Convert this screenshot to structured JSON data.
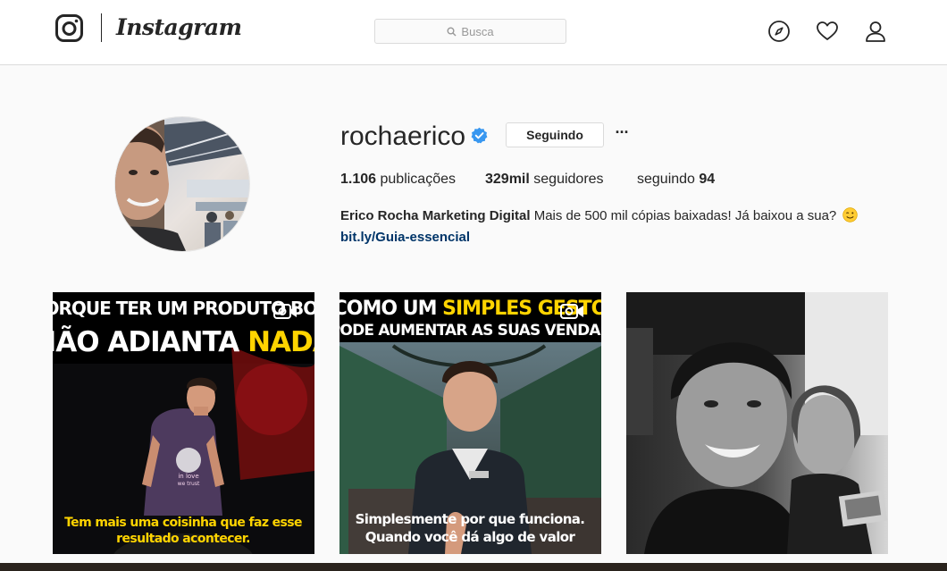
{
  "header": {
    "brand": "Instagram",
    "search_placeholder": "Busca",
    "icons": [
      "instagram-glyph-icon",
      "search-icon",
      "compass-icon",
      "heart-icon",
      "person-icon"
    ]
  },
  "profile": {
    "username": "rochaerico",
    "verified": true,
    "follow_label": "Seguindo",
    "more_label": "···",
    "stats": {
      "posts_value": "1.106",
      "posts_label": "publicações",
      "followers_value": "329mil",
      "followers_label": "seguidores",
      "following_label": "seguindo",
      "following_value": "94"
    },
    "bio_name": "Erico Rocha Marketing Digital",
    "bio_text": "Mais de 500 mil cópias baixadas! Já baixou a sua?",
    "bio_link": "bit.ly/Guia-essencial"
  },
  "posts": [
    {
      "type": "video",
      "title_line1": "PORQUE TER UM PRODUTO BOM",
      "title_line2_a": "NÃO ADIANTA ",
      "title_line2_b": "NADA",
      "shirt_text_1": "in love",
      "shirt_text_2": "we trust",
      "caption_line1": "Tem mais uma coisinha que faz esse",
      "caption_line2": "resultado acontecer."
    },
    {
      "type": "video",
      "title_line1_a": "COMO UM ",
      "title_line1_b": "SIMPLES GESTO",
      "title_line2": "PODE AUMENTAR AS SUAS VENDAS",
      "caption_line1": "Simplesmente por que funciona.",
      "caption_line2": "Quando você dá algo de valor"
    },
    {
      "type": "photo",
      "description": "black-and-white selfie"
    }
  ],
  "colors": {
    "accent_blue": "#3897f0",
    "link_blue": "#003569",
    "title_yellow": "#ffd400",
    "border": "#dbdbdb"
  }
}
